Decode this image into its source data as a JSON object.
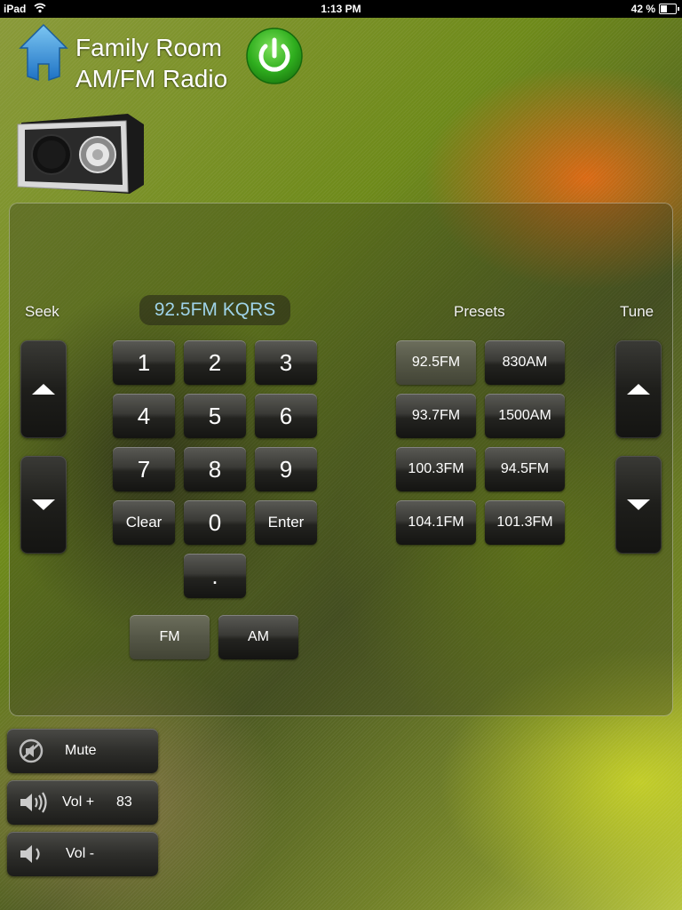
{
  "status_bar": {
    "device": "iPad",
    "time": "1:13 PM",
    "battery": "42 %",
    "battery_level": 0.42
  },
  "header": {
    "room": "Family Room",
    "source": "AM/FM Radio"
  },
  "labels": {
    "seek": "Seek",
    "presets": "Presets",
    "tune": "Tune"
  },
  "station_display": "92.5FM KQRS",
  "keypad": {
    "keys": [
      "1",
      "2",
      "3",
      "4",
      "5",
      "6",
      "7",
      "8",
      "9",
      "Clear",
      "0",
      "Enter",
      "."
    ]
  },
  "presets": [
    "92.5FM",
    "830AM",
    "93.7FM",
    "1500AM",
    "100.3FM",
    "94.5FM",
    "104.1FM",
    "101.3FM"
  ],
  "band": {
    "fm": "FM",
    "am": "AM",
    "selected": "FM"
  },
  "volume": {
    "mute": "Mute",
    "vol_up": "Vol +",
    "vol_down": "Vol -",
    "level": "83"
  },
  "icons": {
    "home": "home-icon",
    "power": "power-icon",
    "radio": "radio-icon",
    "mute": "mute-icon",
    "volume_up": "speaker-loud-icon",
    "volume_down": "speaker-icon"
  },
  "colors": {
    "power_green": "#2fae1e",
    "display_text": "#9fd3e8",
    "home_blue": "#3a9ce0"
  }
}
